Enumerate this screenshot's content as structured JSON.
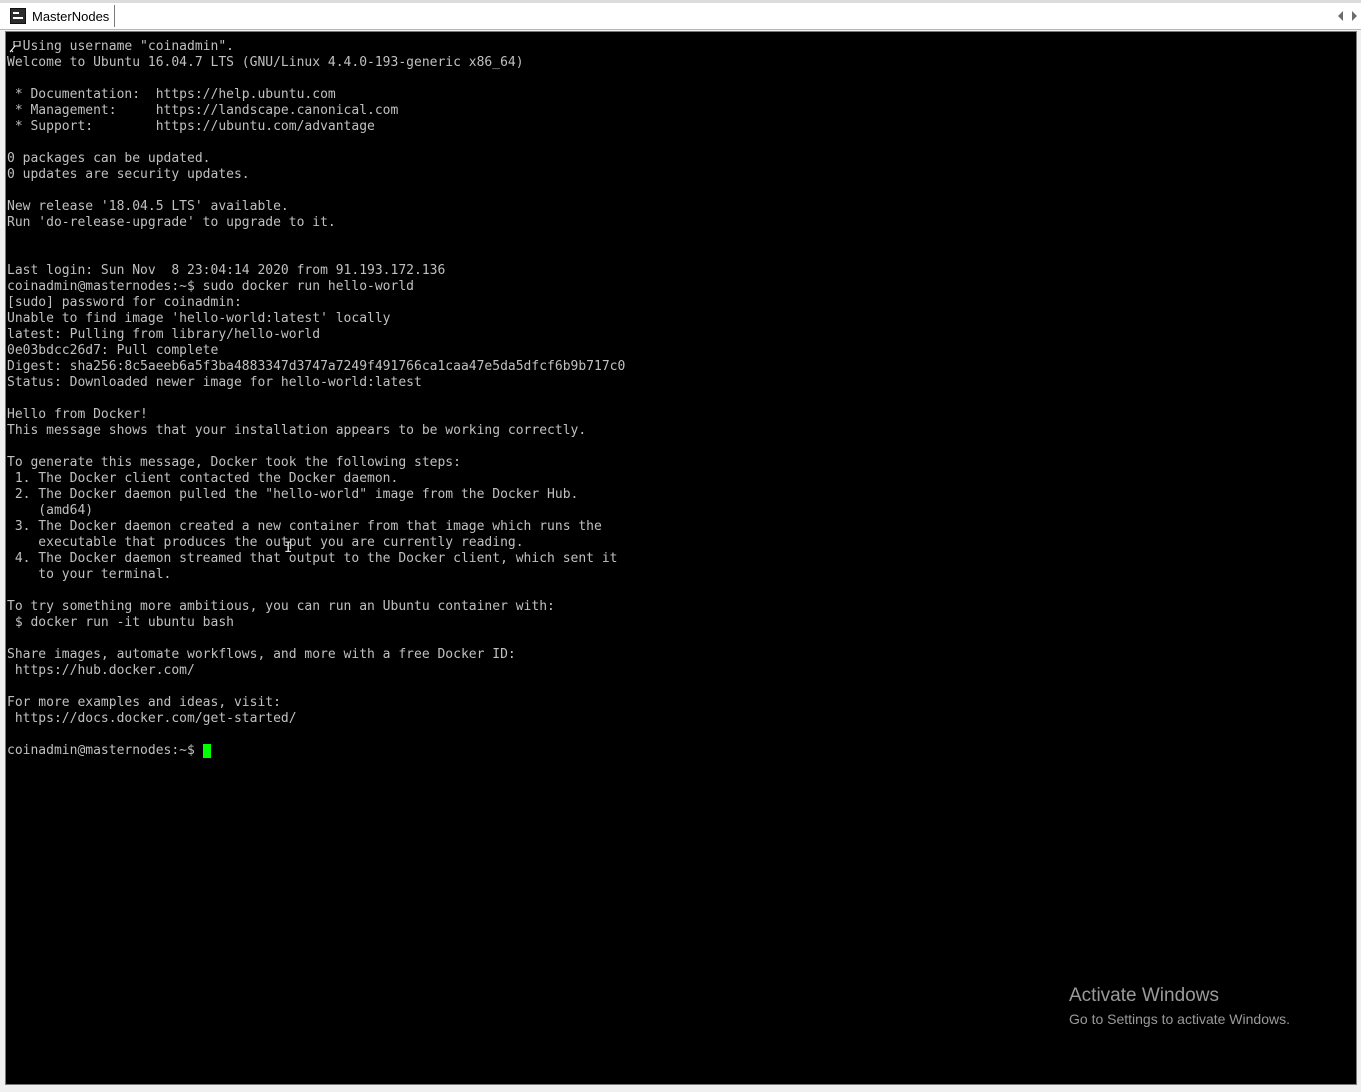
{
  "tab": {
    "icon": "putty-terminal-icon",
    "title": "MasterNodes"
  },
  "terminal": {
    "lines": [
      "  Using username \"coinadmin\".",
      "Welcome to Ubuntu 16.04.7 LTS (GNU/Linux 4.4.0-193-generic x86_64)",
      "",
      " * Documentation:  https://help.ubuntu.com",
      " * Management:     https://landscape.canonical.com",
      " * Support:        https://ubuntu.com/advantage",
      "",
      "0 packages can be updated.",
      "0 updates are security updates.",
      "",
      "New release '18.04.5 LTS' available.",
      "Run 'do-release-upgrade' to upgrade to it.",
      "",
      "",
      "Last login: Sun Nov  8 23:04:14 2020 from 91.193.172.136",
      "coinadmin@masternodes:~$ sudo docker run hello-world",
      "[sudo] password for coinadmin:",
      "Unable to find image 'hello-world:latest' locally",
      "latest: Pulling from library/hello-world",
      "0e03bdcc26d7: Pull complete",
      "Digest: sha256:8c5aeeb6a5f3ba4883347d3747a7249f491766ca1caa47e5da5dfcf6b9b717c0",
      "Status: Downloaded newer image for hello-world:latest",
      "",
      "Hello from Docker!",
      "This message shows that your installation appears to be working correctly.",
      "",
      "To generate this message, Docker took the following steps:",
      " 1. The Docker client contacted the Docker daemon.",
      " 2. The Docker daemon pulled the \"hello-world\" image from the Docker Hub.",
      "    (amd64)",
      " 3. The Docker daemon created a new container from that image which runs the",
      "    executable that produces the output you are currently reading.",
      " 4. The Docker daemon streamed that output to the Docker client, which sent it",
      "    to your terminal.",
      "",
      "To try something more ambitious, you can run an Ubuntu container with:",
      " $ docker run -it ubuntu bash",
      "",
      "Share images, automate workflows, and more with a free Docker ID:",
      " https://hub.docker.com/",
      "",
      "For more examples and ideas, visit:",
      " https://docs.docker.com/get-started/"
    ],
    "prompt": "coinadmin@masternodes:~$",
    "cursor_color": "#00ff00",
    "background_color": "#000000",
    "text_color": "#c0c0c0"
  },
  "watermark": {
    "title": "Activate Windows",
    "subtitle": "Go to Settings to activate Windows."
  }
}
